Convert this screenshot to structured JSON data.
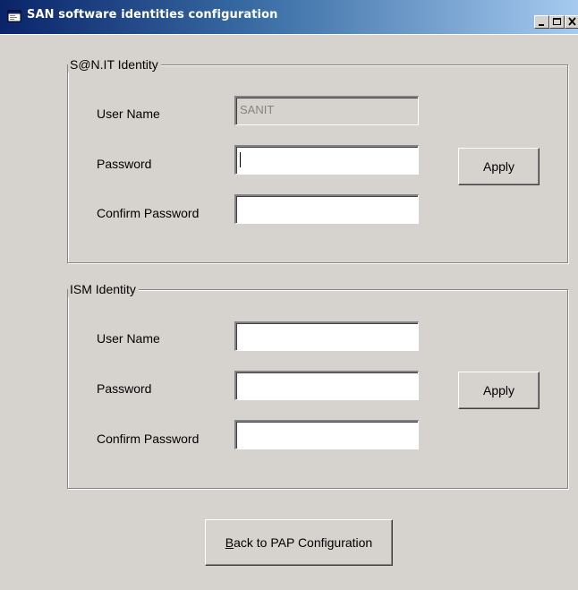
{
  "window": {
    "title": "SAN software identities configuration",
    "icon": "app-window-icon",
    "controls": [
      "minimize-icon",
      "maximize-icon",
      "close-icon"
    ]
  },
  "sanit_identity": {
    "group_label": "S@N.IT Identity",
    "user_name_label": "User Name",
    "user_name_value": "SANIT",
    "user_name_enabled": false,
    "password_label": "Password",
    "password_value": "",
    "confirm_password_label": "Confirm Password",
    "confirm_password_value": "",
    "apply_label": "Apply"
  },
  "ism_identity": {
    "group_label": "ISM Identity",
    "user_name_label": "User Name",
    "user_name_value": "",
    "password_label": "Password",
    "password_value": "",
    "confirm_password_label": "Confirm Password",
    "confirm_password_value": "",
    "apply_label": "Apply"
  },
  "footer": {
    "back_mnemonic": "B",
    "back_rest": "ack to PAP Configuration"
  },
  "colors": {
    "window_bg": "#d6d3ce",
    "title_gradient_start": "#0a246a",
    "title_gradient_end": "#a6caf0"
  }
}
